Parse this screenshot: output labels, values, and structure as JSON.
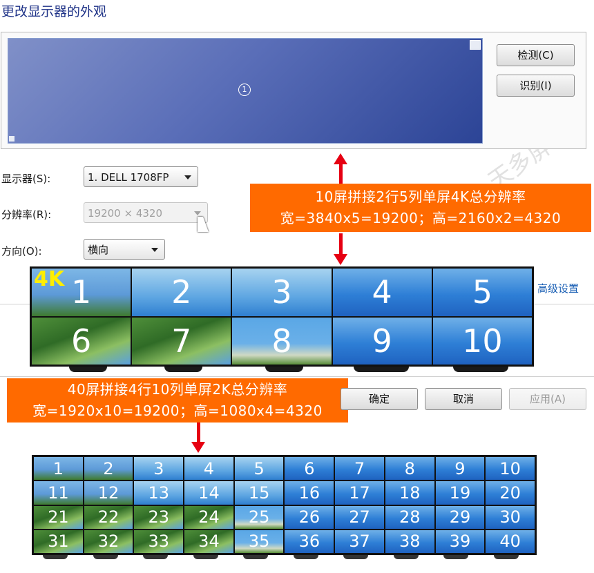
{
  "dialog": {
    "title": "更改显示器的外观",
    "preview": {
      "monitor_number": "1"
    },
    "buttons": {
      "detect": "检测(C)",
      "identify": "识别(I)"
    },
    "fields": {
      "display": {
        "label": "显示器(S):",
        "value": "1. DELL 1708FP"
      },
      "resolution": {
        "label": "分辨率(R):",
        "value": "19200 × 4320"
      },
      "orientation": {
        "label": "方向(O):",
        "value": "横向"
      }
    },
    "advanced_link": "高级设置",
    "footer_buttons": {
      "ok": "确定",
      "cancel": "取消",
      "apply": "应用(A)"
    }
  },
  "annotations": {
    "top": {
      "line1": "10屏拼接2行5列单屏4K总分辨率",
      "line2": "宽=3840x5=19200；高=2160x2=4320"
    },
    "bottom": {
      "line1": "40屏拼接4行10列单屏2K总分辨率",
      "line2": "宽=1920x10=19200；高=1080x4=4320"
    }
  },
  "wall_4k": {
    "badge": "4K",
    "rows": 2,
    "cols": 5,
    "panels": [
      "1",
      "2",
      "3",
      "4",
      "5",
      "6",
      "7",
      "8",
      "9",
      "10"
    ]
  },
  "wall_2k": {
    "rows": 4,
    "cols": 10,
    "panels": [
      "1",
      "2",
      "3",
      "4",
      "5",
      "6",
      "7",
      "8",
      "9",
      "10",
      "11",
      "12",
      "13",
      "14",
      "15",
      "16",
      "17",
      "18",
      "19",
      "20",
      "21",
      "22",
      "23",
      "24",
      "25",
      "26",
      "27",
      "28",
      "29",
      "30",
      "31",
      "32",
      "33",
      "34",
      "35",
      "36",
      "37",
      "38",
      "39",
      "40"
    ]
  },
  "watermark": "天多屏",
  "colors": {
    "annotation_bg": "#ff6a00",
    "arrow": "#e60012",
    "badge": "#ffee00",
    "link": "#1a5fb4"
  }
}
